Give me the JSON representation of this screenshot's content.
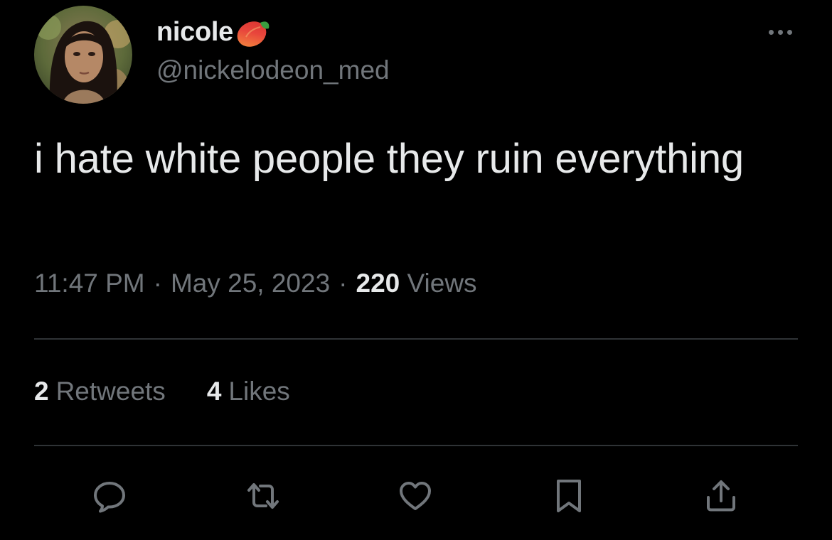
{
  "author": {
    "display_name": "nicole",
    "name_emoji": "peach-emoji",
    "handle": "@nickelodeon_med",
    "avatar": "profile-photo"
  },
  "tweet": {
    "text": "i hate white people they ruin everything",
    "time": "11:47 PM",
    "separator": "·",
    "date": "May 25, 2023",
    "views_count": "220",
    "views_label": "Views"
  },
  "stats": {
    "retweets_count": "2",
    "retweets_label": "Retweets",
    "likes_count": "4",
    "likes_label": "Likes"
  },
  "actions": [
    {
      "icon": "reply-icon"
    },
    {
      "icon": "retweet-icon"
    },
    {
      "icon": "like-icon"
    },
    {
      "icon": "bookmark-icon"
    },
    {
      "icon": "share-icon"
    }
  ],
  "colors": {
    "background": "#000000",
    "primary_text": "#e7e9ea",
    "secondary_text": "#71767b",
    "divider": "#2f3336",
    "peach_red": "#e8453c",
    "peach_orange": "#f5923e",
    "leaf_green": "#3a9d3f"
  }
}
